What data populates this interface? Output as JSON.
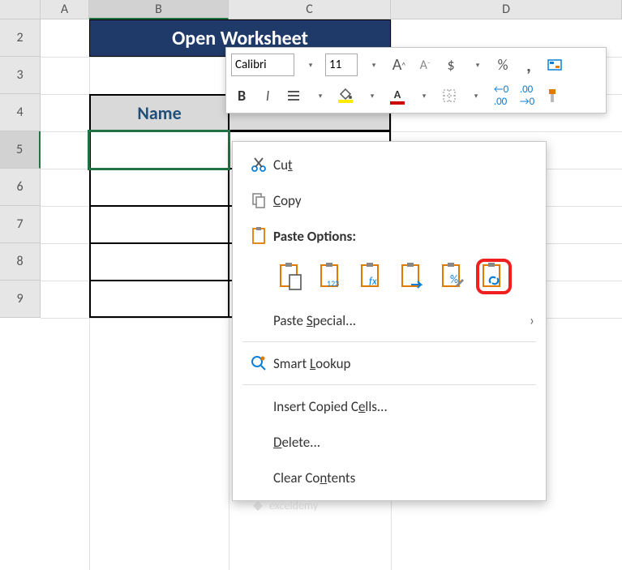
{
  "columns": {
    "A": "A",
    "B": "B",
    "C": "C",
    "D": "D"
  },
  "rows": {
    "r2": "2",
    "r3": "3",
    "r4": "4",
    "r5": "5",
    "r6": "6",
    "r7": "7",
    "r8": "8",
    "r9": "9"
  },
  "title_cell": "Open Worksheet",
  "table_headers": {
    "name": "Name",
    "salary": ""
  },
  "mini_toolbar": {
    "font_name": "Calibri",
    "font_size": "11",
    "increase_font_tip": "A^",
    "decrease_font_tip": "A",
    "dollar": "$",
    "percent": "%",
    "comma": ",",
    "bold": "B",
    "italic": "I"
  },
  "context_menu": {
    "cut": "Cut",
    "copy": "Copy",
    "paste_options_header": "Paste Options:",
    "paste_special": "Paste Special...",
    "smart_lookup": "Smart Lookup",
    "insert_copied": "Insert Copied Cells...",
    "delete": "Delete...",
    "clear_contents": "Clear Contents",
    "paste_options": [
      {
        "name": "paste",
        "label": "Paste"
      },
      {
        "name": "paste-values",
        "label": "Values"
      },
      {
        "name": "paste-formulas",
        "label": "Formulas"
      },
      {
        "name": "paste-transpose",
        "label": "Transpose"
      },
      {
        "name": "paste-formatting",
        "label": "Formatting"
      },
      {
        "name": "paste-link",
        "label": "Paste Link"
      }
    ]
  },
  "watermark": "exceldemy"
}
